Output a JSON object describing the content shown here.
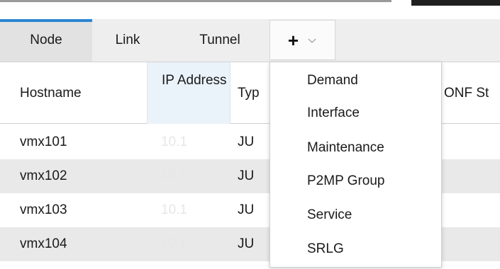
{
  "tabs": [
    {
      "label": "Node",
      "active": true
    },
    {
      "label": "Link",
      "active": false
    },
    {
      "label": "Tunnel",
      "active": false
    }
  ],
  "add_button": {
    "icon": "plus-icon",
    "chevron": "chevron-down-icon"
  },
  "table": {
    "columns": [
      "Hostname",
      "IP Address",
      "Typ",
      "ONF St"
    ],
    "rows": [
      {
        "hostname": "vmx101",
        "ip": "10.1",
        "type": "JU"
      },
      {
        "hostname": "vmx102",
        "ip": "10.1",
        "type": "JU"
      },
      {
        "hostname": "vmx103",
        "ip": "10.1",
        "type": "JU"
      },
      {
        "hostname": "vmx104",
        "ip": "10.1",
        "type": "JU"
      }
    ]
  },
  "menu": {
    "items": [
      "Demand",
      "Interface",
      "Maintenance",
      "P2MP Group",
      "Service",
      "SRLG"
    ]
  },
  "colors": {
    "active_tab_accent": "#2a86d1",
    "tab_bar_bg": "#eeeeee",
    "sorted_header_bg": "#eaf2fa",
    "alt_row_bg": "#e9e9e9"
  }
}
